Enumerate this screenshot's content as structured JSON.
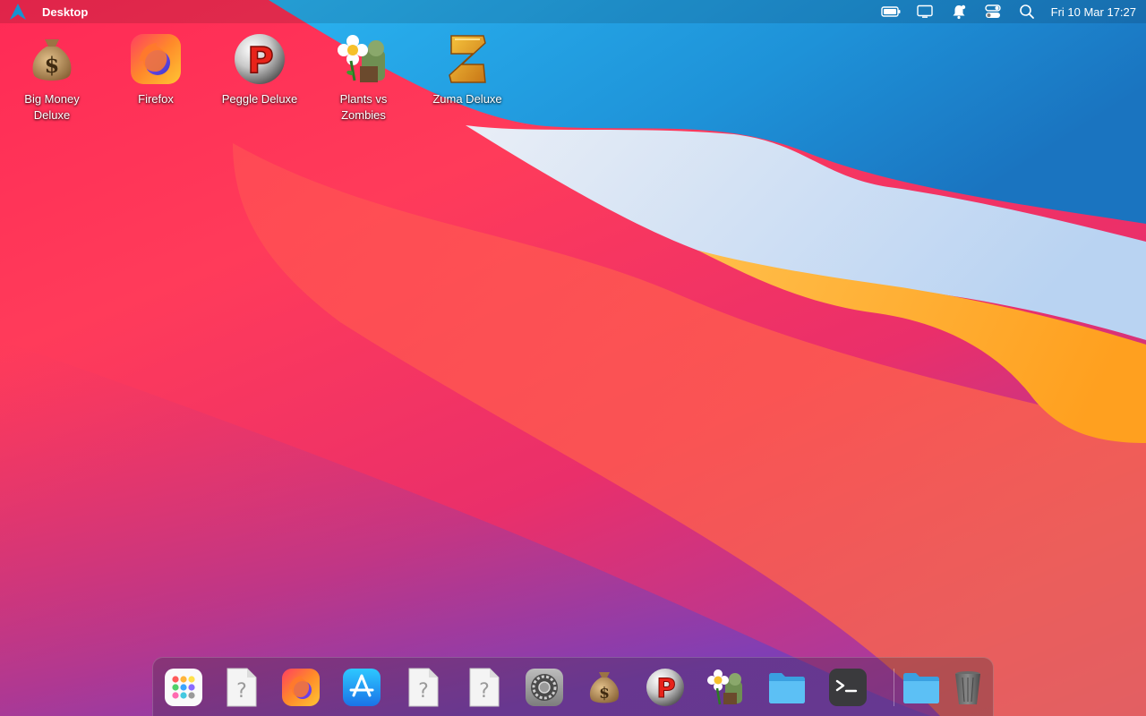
{
  "topbar": {
    "title": "Desktop",
    "clock": "Fri 10 Mar 17:27",
    "tray_icons": [
      "battery-icon",
      "display-icon",
      "notification-bell-icon",
      "control-center-icon",
      "search-icon"
    ]
  },
  "desktop_icons": [
    {
      "label": "Big Money Deluxe",
      "icon": "money-bag-icon"
    },
    {
      "label": "Firefox",
      "icon": "firefox-icon"
    },
    {
      "label": "Peggle Deluxe",
      "icon": "peggle-icon"
    },
    {
      "label": "Plants vs Zombies",
      "icon": "plants-vs-zombies-icon"
    },
    {
      "label": "Zuma Deluxe",
      "icon": "zuma-icon"
    }
  ],
  "dock": {
    "items": [
      {
        "icon": "launchpad-icon",
        "running": false
      },
      {
        "icon": "unknown-file-icon",
        "running": false
      },
      {
        "icon": "firefox-icon",
        "running": false
      },
      {
        "icon": "app-store-icon",
        "running": true
      },
      {
        "icon": "unknown-file-icon",
        "running": false
      },
      {
        "icon": "unknown-file-icon",
        "running": false
      },
      {
        "icon": "system-settings-icon",
        "running": false
      },
      {
        "icon": "money-bag-icon",
        "running": false
      },
      {
        "icon": "peggle-icon",
        "running": false
      },
      {
        "icon": "plants-vs-zombies-icon",
        "running": true
      },
      {
        "icon": "folder-icon",
        "running": true
      },
      {
        "icon": "terminal-icon",
        "running": true
      },
      {
        "icon": "folder-icon",
        "running": false
      },
      {
        "icon": "trash-icon",
        "running": false
      }
    ]
  },
  "colors": {
    "wallpaper_red": "#ff2a55",
    "wallpaper_blue": "#1f8fd6",
    "wallpaper_orange": "#ffa126"
  }
}
